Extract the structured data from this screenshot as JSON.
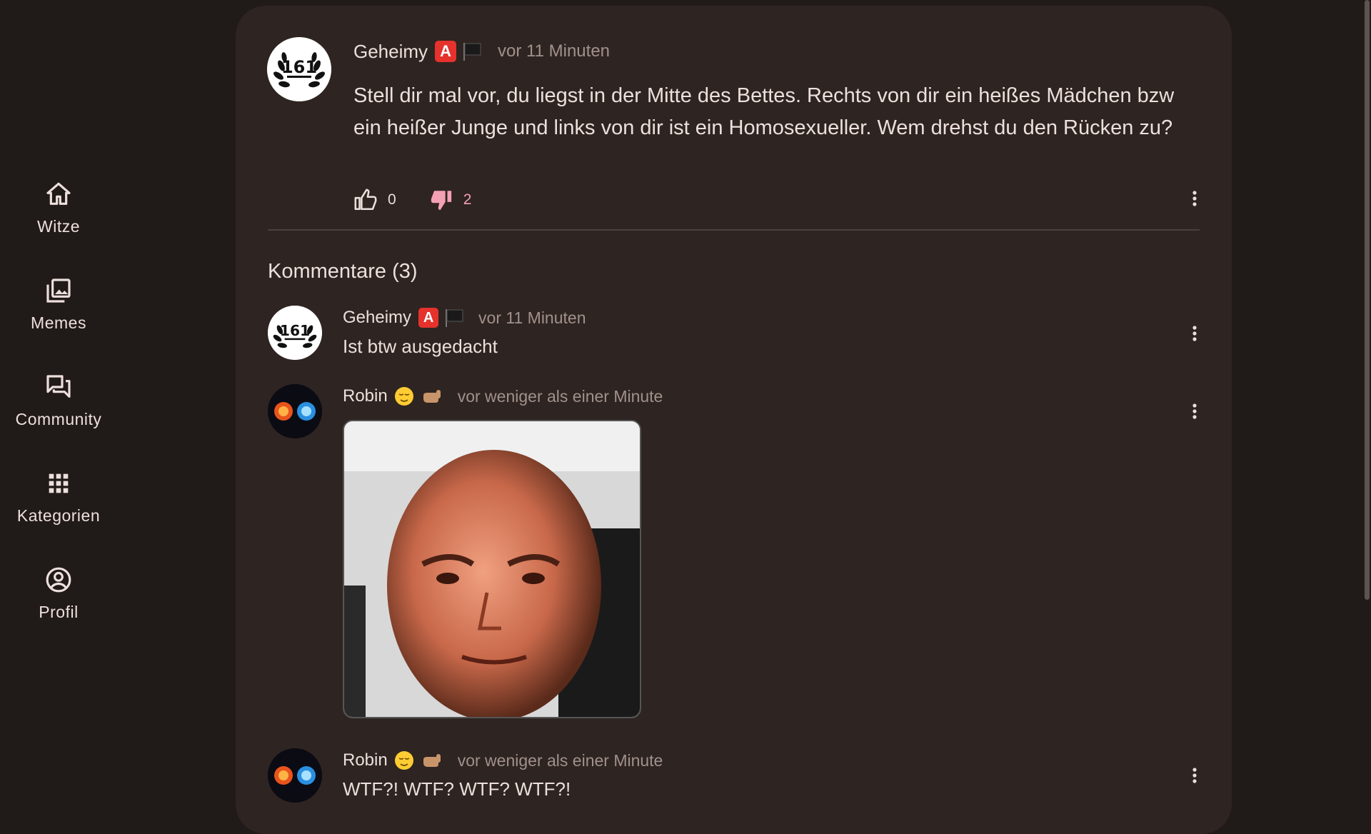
{
  "nav": {
    "items": [
      {
        "label": "Witze",
        "icon": "home-icon"
      },
      {
        "label": "Memes",
        "icon": "image-library-icon"
      },
      {
        "label": "Community",
        "icon": "forum-icon"
      },
      {
        "label": "Kategorien",
        "icon": "grid-icon"
      },
      {
        "label": "Profil",
        "icon": "account-circle-icon"
      }
    ]
  },
  "post": {
    "author": "Geheimy",
    "badge": "A",
    "time": "vor 11 Minuten",
    "avatar_text": "161",
    "text": "Stell dir mal vor, du liegst in der Mitte des Bettes. Rechts von dir ein heißes Mädchen bzw ein heißer Junge und links von dir ist ein Homosexueller. Wem drehst du den Rücken zu?",
    "likes": "0",
    "dislikes": "2"
  },
  "comments_title": "Kommentare (3)",
  "comments": [
    {
      "author": "Geheimy",
      "badge": "A",
      "time": "vor 11 Minuten",
      "text": "Ist btw ausgedacht",
      "avatar_text": "161"
    },
    {
      "author": "Robin",
      "time": "vor weniger als einer Minute",
      "text": ""
    },
    {
      "author": "Robin",
      "time": "vor weniger als einer Minute",
      "text": "WTF?! WTF? WTF? WTF?!"
    }
  ],
  "colors": {
    "background": "#201a18",
    "card": "#2e2421",
    "dislike_active": "#f4a0b4",
    "muted_text": "#a1918c"
  }
}
